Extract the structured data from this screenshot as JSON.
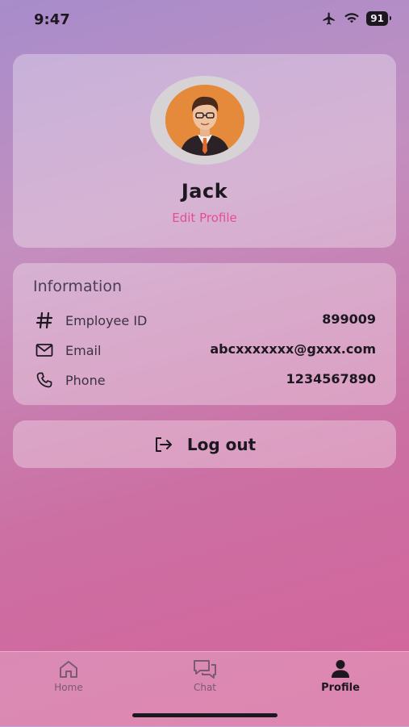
{
  "status_bar": {
    "time": "9:47",
    "battery": "91"
  },
  "profile": {
    "name": "Jack",
    "edit_label": "Edit Profile"
  },
  "information": {
    "title": "Information",
    "rows": [
      {
        "label": "Employee ID",
        "value": "899009",
        "icon": "hash-icon"
      },
      {
        "label": "Email",
        "value": "abcxxxxxxx@gxxx.com",
        "icon": "mail-icon"
      },
      {
        "label": "Phone",
        "value": "1234567890",
        "icon": "phone-icon"
      }
    ]
  },
  "logout": {
    "label": "Log out",
    "icon": "logout-icon"
  },
  "tabs": [
    {
      "label": "Home",
      "icon": "home-icon",
      "active": false
    },
    {
      "label": "Chat",
      "icon": "chat-icon",
      "active": false
    },
    {
      "label": "Profile",
      "icon": "person-icon",
      "active": true
    }
  ],
  "colors": {
    "accent": "#e64d96",
    "text": "#1d1720"
  }
}
